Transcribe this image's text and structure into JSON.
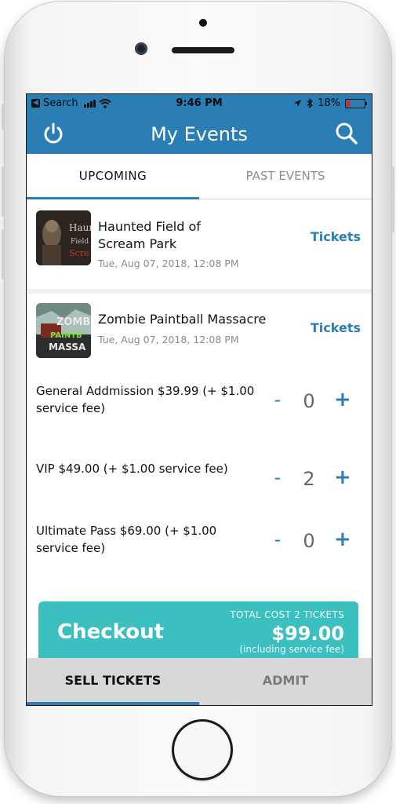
{
  "status_bar": {
    "back_label": "Search",
    "time": "9:46 PM",
    "battery": "18%",
    "battery_level": 0.18,
    "icons": [
      "back-app-icon",
      "signal-icon",
      "wifi-icon",
      "location-icon",
      "bluetooth-icon",
      "battery-icon"
    ]
  },
  "app_bar": {
    "title": "My Events",
    "left_icon": "power-icon",
    "right_icon": "search-icon"
  },
  "tabs": [
    {
      "label": "UPCOMING",
      "active": true
    },
    {
      "label": "PAST EVENTS",
      "active": false
    }
  ],
  "events": [
    {
      "title_line1": "Haunted Field of",
      "title_line2": "Scream Park",
      "date": "Tue, Aug 07, 2018, 12:08 PM",
      "action": "Tickets",
      "thumb_text": [
        "Haunt",
        "Field",
        "Scre"
      ]
    },
    {
      "title_line1": "Zombie Paintball Massacre",
      "date": "Tue, Aug 07, 2018, 12:08 PM",
      "action": "Tickets",
      "thumb_text": [
        "ZOMB",
        "PAINTB",
        "MASSA"
      ]
    }
  ],
  "ticket_types": [
    {
      "line1": "General Addmission $39.99 (+ $1.00",
      "line2": "service fee)",
      "minus": "-",
      "qty": "0",
      "plus": "+"
    },
    {
      "line1": "VIP $49.00 (+ $1.00 service fee)",
      "line2": "",
      "minus": "-",
      "qty": "2",
      "plus": "+"
    },
    {
      "line1": "Ultimate Pass $69.00 (+ $1.00",
      "line2": "service fee)",
      "minus": "-",
      "qty": "0",
      "plus": "+"
    }
  ],
  "checkout": {
    "label": "Checkout",
    "total_label": "TOTAL COST 2 TICKETS",
    "amount": "$99.00",
    "note": "(including service fee)"
  },
  "bottom_nav": [
    {
      "label": "SELL TICKETS",
      "active": true
    },
    {
      "label": "ADMIT",
      "active": false
    }
  ],
  "colors": {
    "primary": "#2a7eb4",
    "checkout": "#3cbfbf",
    "bottom_nav_bg": "#d8d8d8"
  }
}
